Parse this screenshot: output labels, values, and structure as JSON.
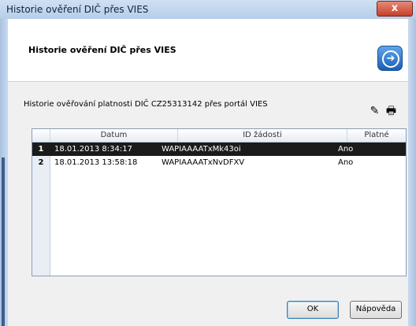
{
  "window": {
    "title": "Historie ověření DIČ přes VIES",
    "close_label": "x"
  },
  "header": {
    "heading": "Historie ověření DIČ přes VIES",
    "help_icon": "help-arrow-icon"
  },
  "info_text": "Historie ověřování platnosti DIČ CZ25313142 přes portál VIES",
  "toolbar": {
    "icons": [
      "edit-icon",
      "print-icon"
    ]
  },
  "table": {
    "columns": [
      "Datum",
      "ID žádosti",
      "Platné"
    ],
    "rows": [
      {
        "num": "1",
        "date": "18.01.2013 8:34:17",
        "id": "WAPIAAAATxMk43oi",
        "valid": "Ano"
      },
      {
        "num": "2",
        "date": "18.01.2013 13:58:18",
        "id": "WAPIAAAATxNvDFXV",
        "valid": "Ano"
      }
    ]
  },
  "buttons": {
    "ok": "OK",
    "help": "Nápověda"
  }
}
